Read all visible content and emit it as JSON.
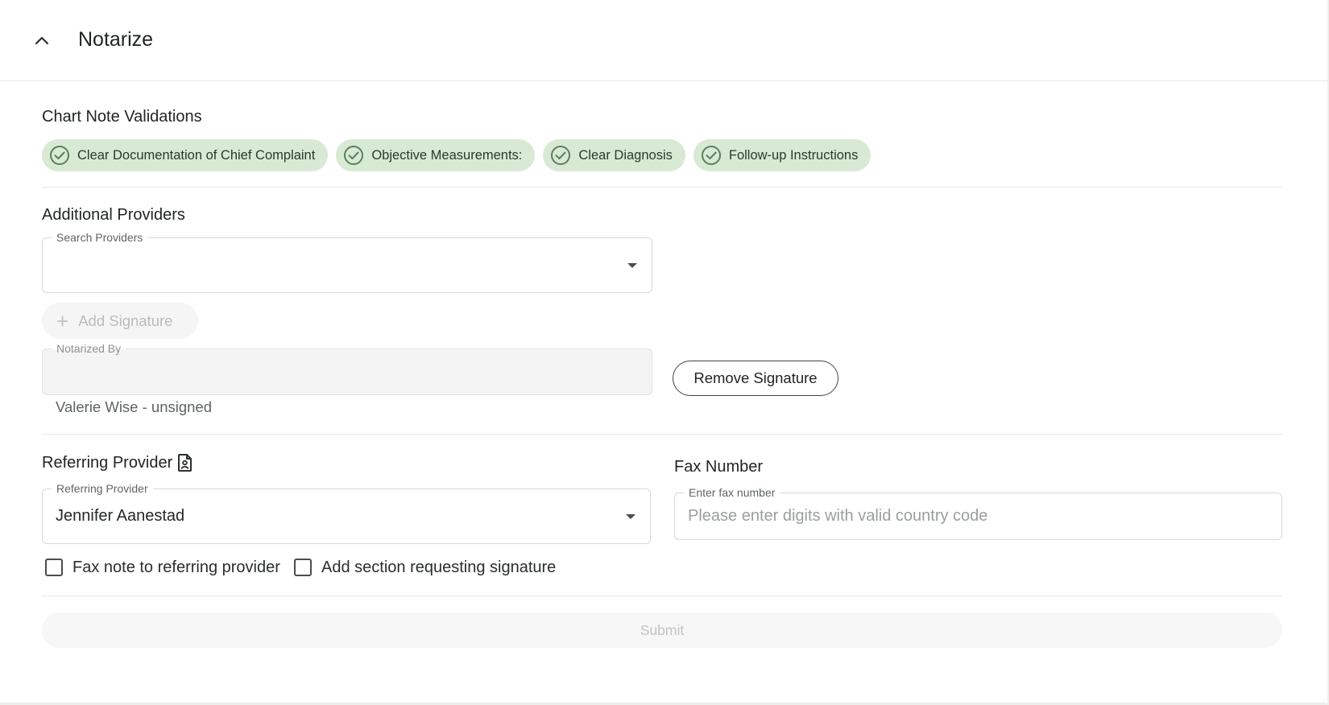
{
  "header": {
    "title": "Notarize",
    "collapse_icon": "chevron-up-icon"
  },
  "validations": {
    "title": "Chart Note Validations",
    "accent_color": "#d8e9d4",
    "check_color": "#5b7f5d",
    "chips": [
      {
        "label": "Clear Documentation of Chief Complaint",
        "icon": "check-circle-icon"
      },
      {
        "label": "Objective Measurements:",
        "icon": "check-circle-icon"
      },
      {
        "label": "Clear Diagnosis",
        "icon": "check-circle-icon"
      },
      {
        "label": "Follow-up Instructions",
        "icon": "check-circle-icon"
      }
    ]
  },
  "providers": {
    "title": "Additional Providers",
    "search_label": "Search Providers",
    "search_value": "",
    "add_signature_label": "Add Signature",
    "notarized_by_label": "Notarized By",
    "notarized_by_value": "",
    "remove_signature_label": "Remove Signature",
    "signer_status": "Valerie Wise - unsigned"
  },
  "referring": {
    "title": "Referring Provider",
    "title_icon": "document-person-icon",
    "field_label": "Referring Provider",
    "value": "Jennifer Aanestad"
  },
  "fax": {
    "title": "Fax Number",
    "field_label": "Enter fax number",
    "placeholder": "Please enter digits with valid country code",
    "value": ""
  },
  "options": {
    "fax_note_label": "Fax note to referring provider",
    "fax_note_checked": false,
    "request_signature_label": "Add section requesting signature",
    "request_signature_checked": false
  },
  "submit_label": "Submit"
}
